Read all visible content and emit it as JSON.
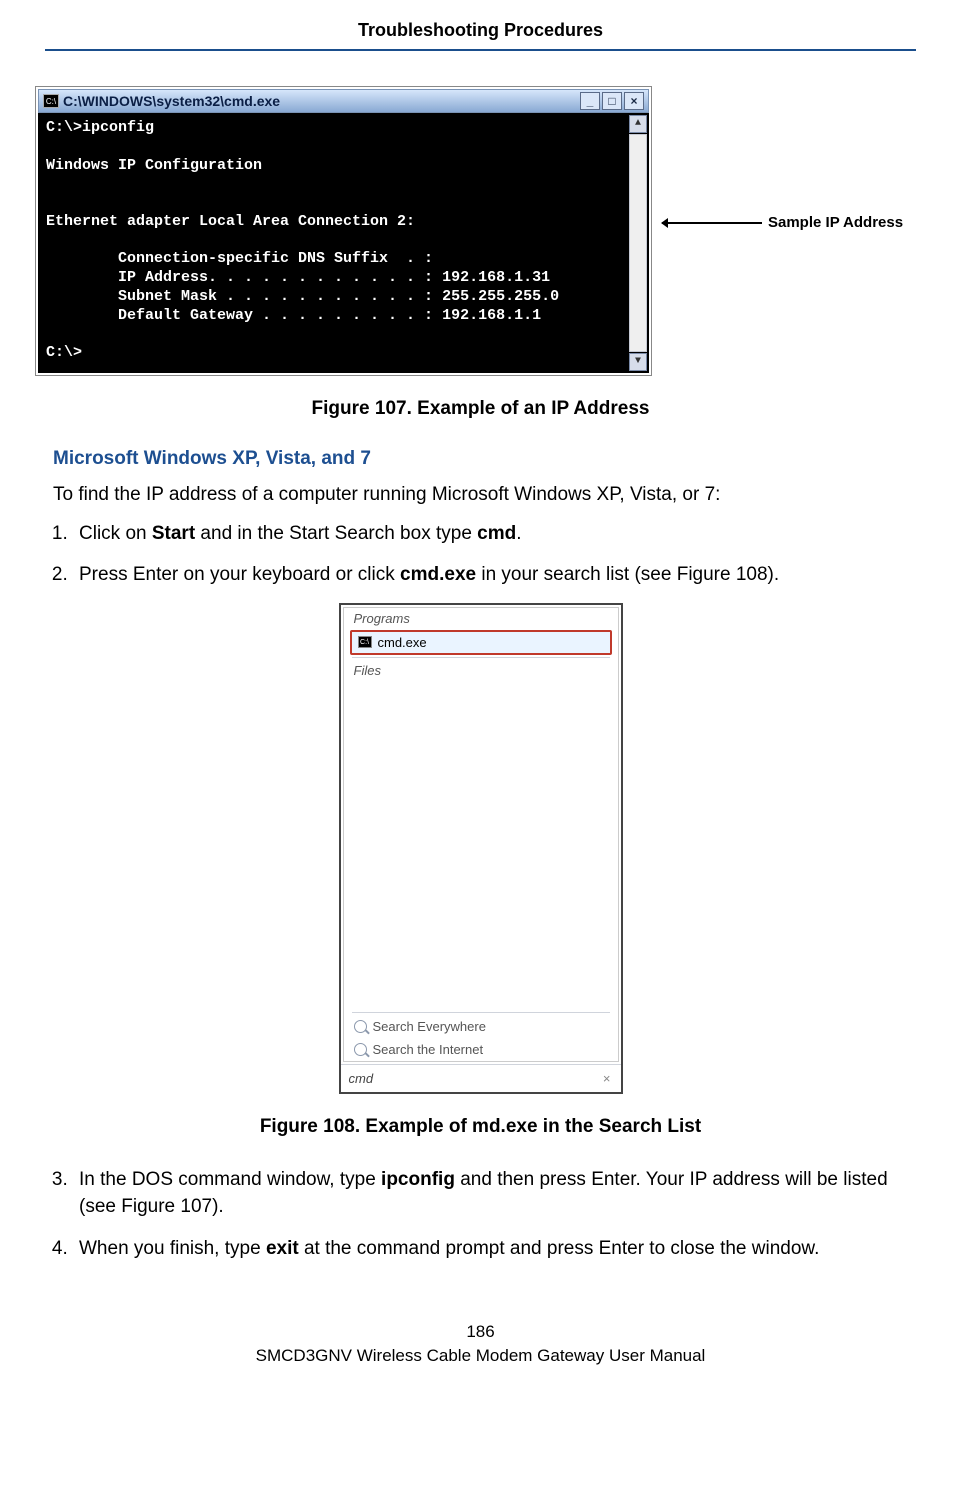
{
  "header": {
    "title": "Troubleshooting Procedures"
  },
  "cmd": {
    "titlebar": "C:\\WINDOWS\\system32\\cmd.exe",
    "min_btn": "_",
    "max_btn": "□",
    "close_btn": "×",
    "scroll_up": "▲",
    "scroll_down": "▼",
    "line1": "C:\\>ipconfig",
    "line2": "Windows IP Configuration",
    "line3": "Ethernet adapter Local Area Connection 2:",
    "line4": "        Connection-specific DNS Suffix  . :",
    "line5": "        IP Address. . . . . . . . . . . . : 192.168.1.31",
    "line6": "        Subnet Mask . . . . . . . . . . . : 255.255.255.0",
    "line7": "        Default Gateway . . . . . . . . . : 192.168.1.1",
    "line8": "C:\\>"
  },
  "callout": {
    "label": "Sample IP Address"
  },
  "fig107": "Figure 107. Example of an IP Address",
  "section_heading": "Microsoft Windows XP, Vista, and 7",
  "intro_text": "To find the IP address of a computer running Microsoft Windows XP, Vista, or 7:",
  "steps": {
    "s1a": "Click on ",
    "s1b": "Start",
    "s1c": " and in the Start Search box type ",
    "s1d": "cmd",
    "s1e": ".",
    "s2a": "Press Enter on your keyboard or click ",
    "s2b": "cmd.exe",
    "s2c": " in your search list (see Figure 108).",
    "s3a": "In the DOS command window, type ",
    "s3b": "ipconfig",
    "s3c": " and then press Enter. Your IP address will be listed (see Figure 107).",
    "s4a": "When you finish, type ",
    "s4b": "exit",
    "s4c": " at the command prompt and press Enter to close the window."
  },
  "search": {
    "programs_label": "Programs",
    "item": "cmd.exe",
    "files_label": "Files",
    "everywhere": "Search Everywhere",
    "internet": "Search the Internet",
    "input": "cmd",
    "clear": "×"
  },
  "fig108": "Figure 108. Example of md.exe in the Search List",
  "footer": {
    "page": "186",
    "manual": "SMCD3GNV Wireless Cable Modem Gateway User Manual"
  }
}
